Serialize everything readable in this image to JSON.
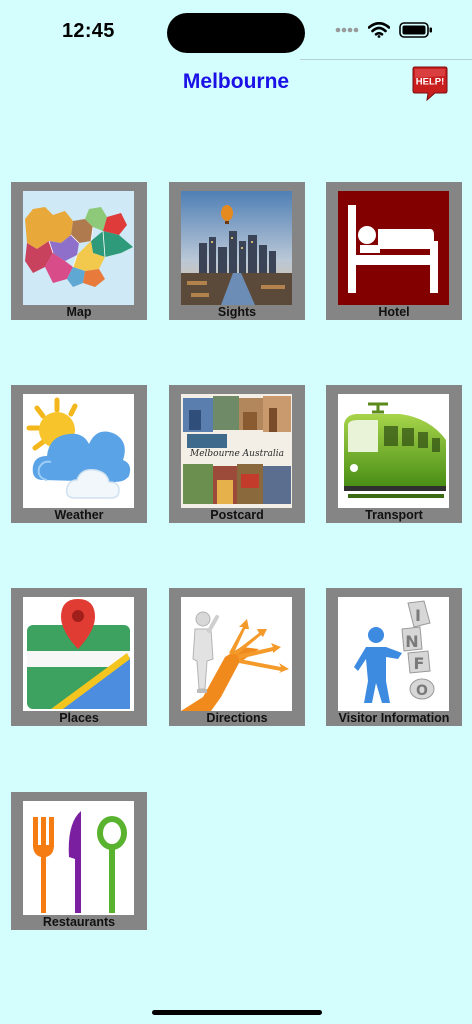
{
  "status": {
    "time": "12:45"
  },
  "header": {
    "title": "Melbourne",
    "help_label": "HELP!"
  },
  "tiles": [
    {
      "label": "Map",
      "icon": "victoria-map-icon"
    },
    {
      "label": "Sights",
      "icon": "city-skyline-icon"
    },
    {
      "label": "Hotel",
      "icon": "hotel-bed-icon"
    },
    {
      "label": "Weather",
      "icon": "weather-sun-cloud-icon"
    },
    {
      "label": "Postcard",
      "icon": "postcard-collage-icon",
      "caption": "Melbourne Australia"
    },
    {
      "label": "Transport",
      "icon": "train-icon"
    },
    {
      "label": "Places",
      "icon": "map-pin-icon"
    },
    {
      "label": "Directions",
      "icon": "directions-arrows-icon"
    },
    {
      "label": "Visitor Information",
      "icon": "info-figure-icon"
    },
    {
      "label": "Restaurants",
      "icon": "cutlery-icon"
    }
  ],
  "colors": {
    "background": "#d4fdfd",
    "title": "#1b10e6",
    "tile_frame": "#858585",
    "help_red": "#c81e1e"
  }
}
